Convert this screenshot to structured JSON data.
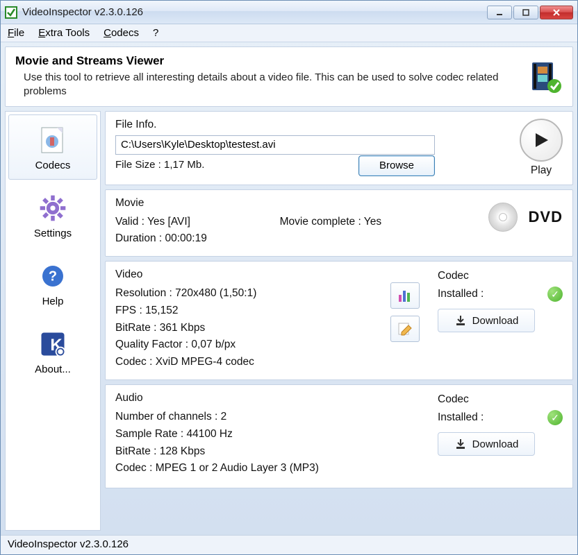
{
  "window": {
    "title": "VideoInspector v2.3.0.126"
  },
  "menu": {
    "file": "File",
    "extra": "Extra Tools",
    "codecs": "Codecs",
    "help": "?"
  },
  "header": {
    "title": "Movie and Streams Viewer",
    "desc": "Use this tool to retrieve all interesting details about a video file. This can be used to solve codec related problems"
  },
  "sidebar": {
    "codecs": "Codecs",
    "settings": "Settings",
    "help": "Help",
    "about": "About..."
  },
  "fileinfo": {
    "title": "File Info.",
    "path": "C:\\Users\\Kyle\\Desktop\\testest.avi",
    "size": "File Size : 1,17 Mb.",
    "browse": "Browse",
    "play": "Play"
  },
  "movie": {
    "title": "Movie",
    "valid": "Valid : Yes [AVI]",
    "complete": "Movie complete : Yes",
    "duration": "Duration : 00:00:19",
    "dvd": "DVD"
  },
  "video": {
    "title": "Video",
    "resolution": "Resolution : 720x480 (1,50:1)",
    "fps": "FPS : 15,152",
    "bitrate": "BitRate : 361 Kbps",
    "quality": "Quality Factor : 0,07 b/px",
    "codec": "Codec : XviD MPEG-4 codec"
  },
  "audio": {
    "title": "Audio",
    "channels": "Number of channels : 2",
    "samplerate": "Sample Rate : 44100 Hz",
    "bitrate": "BitRate : 128 Kbps",
    "codec": "Codec : MPEG 1 or 2 Audio Layer 3 (MP3)"
  },
  "codecbox": {
    "title": "Codec",
    "installed": "Installed :",
    "download": "Download"
  },
  "statusbar": "VideoInspector v2.3.0.126"
}
